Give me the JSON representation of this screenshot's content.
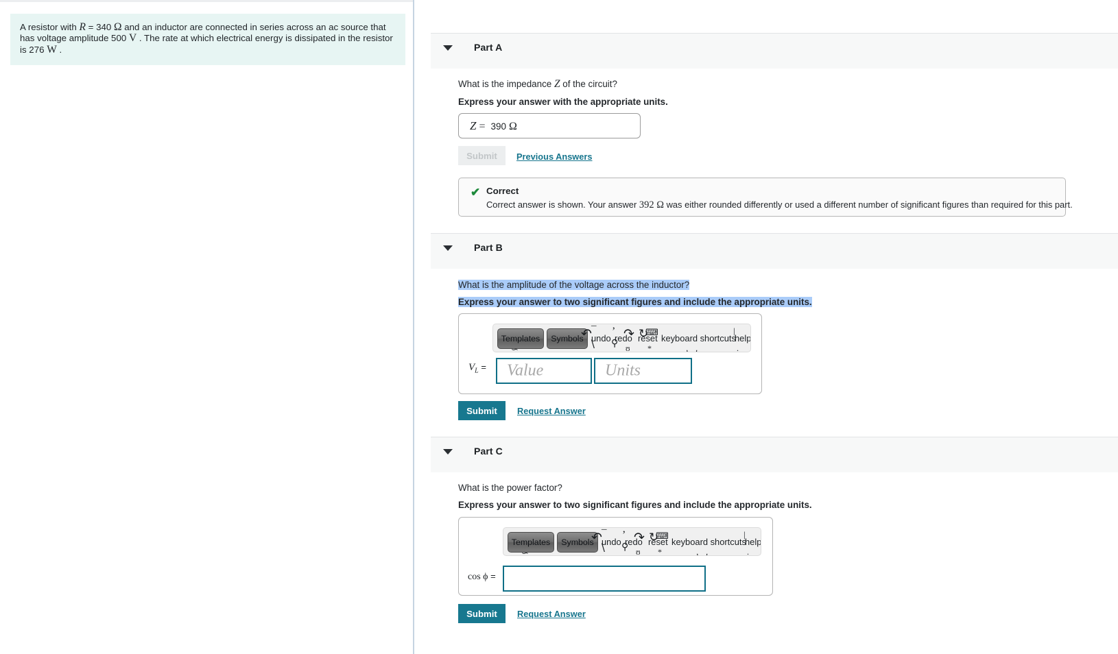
{
  "problem": {
    "segments": [
      {
        "t": "A resistor with ",
        "k": "plain"
      },
      {
        "t": "R",
        "k": "var"
      },
      {
        "t": " = 340 ",
        "k": "plain"
      },
      {
        "t": "Ω",
        "k": "unit"
      },
      {
        "t": " and an inductor are connected in series across an ac source that has voltage amplitude 500 ",
        "k": "plain"
      },
      {
        "t": "V",
        "k": "unit"
      },
      {
        "t": " . The rate at which electrical energy is dissipated in the resistor is 276 ",
        "k": "plain"
      },
      {
        "t": "W",
        "k": "unit"
      },
      {
        "t": " .",
        "k": "plain"
      }
    ],
    "full_text": "A resistor with R = 340 Ω and an inductor are connected in series across an ac source that has voltage amplitude 500 V . The rate at which electrical energy is dissipated in the resistor is 276 W ."
  },
  "colors": {
    "accent_teal": "#17788f",
    "link_teal": "#16758d",
    "problem_bg": "#e7f5f3",
    "header_band": "#f7f8f8",
    "selection_blue": "#aaccf9",
    "correct_green": "#1d8a3b",
    "input_border_teal": "#0f6f87",
    "divider_blue": "#c6d4e1"
  },
  "parts": [
    {
      "id": "part-a",
      "title": "Part A",
      "caret_icon": "chevron-down-icon",
      "question": "What is the impedance Z of the circuit?",
      "question_pre": "What is the impedance ",
      "question_var": "Z",
      "question_post": " of the circuit?",
      "instruction": "Express your answer with the appropriate units.",
      "answer_var": "Z",
      "answer_eq": "=",
      "answer_value": "390",
      "answer_unit": "Ω",
      "submit_label": "Submit",
      "submit_disabled": true,
      "secondary_link": "Previous Answers",
      "feedback": {
        "icon": "check-icon",
        "title": "Correct",
        "body_pre": "Correct answer is shown. Your answer ",
        "body_value": "392",
        "body_unit": "Ω",
        "body_post": " was either rounded differently or used a different number of significant figures than required for this part."
      }
    },
    {
      "id": "part-b",
      "title": "Part B",
      "caret_icon": "chevron-down-icon",
      "question": "What is the amplitude of the voltage across the inductor?",
      "instruction": "Express your answer to two significant figures and include the appropriate units.",
      "selected": true,
      "var_label_main": "V",
      "var_label_sub": "L",
      "var_label_eq": "=",
      "value_placeholder": "Value",
      "units_placeholder": "Units",
      "submit_label": "Submit",
      "submit_disabled": false,
      "secondary_link": "Request Answer"
    },
    {
      "id": "part-c",
      "title": "Part C",
      "caret_icon": "chevron-down-icon",
      "question": "What is the power factor?",
      "instruction": "Express your answer to two significant figures and include the appropriate units.",
      "selected": false,
      "var_label_main": "cos ϕ",
      "var_label_eq": "=",
      "value_placeholder": "",
      "submit_label": "Submit",
      "submit_disabled": false,
      "secondary_link": "Request Answer"
    }
  ],
  "math_toolbar": {
    "templates_label": "Templates",
    "symbols_label": "Symbols",
    "undo_label": "undo",
    "redo_label": "redo",
    "reset_label": "reset",
    "keyboard_shortcuts_label": "keyboard shortcuts",
    "help_label": "help",
    "undo_icon": "undo-arrow-icon",
    "redo_icon": "redo-arrow-icon",
    "reset_icon": "reset-arrow-icon",
    "keyboard_icon": "keyboard-icon"
  }
}
